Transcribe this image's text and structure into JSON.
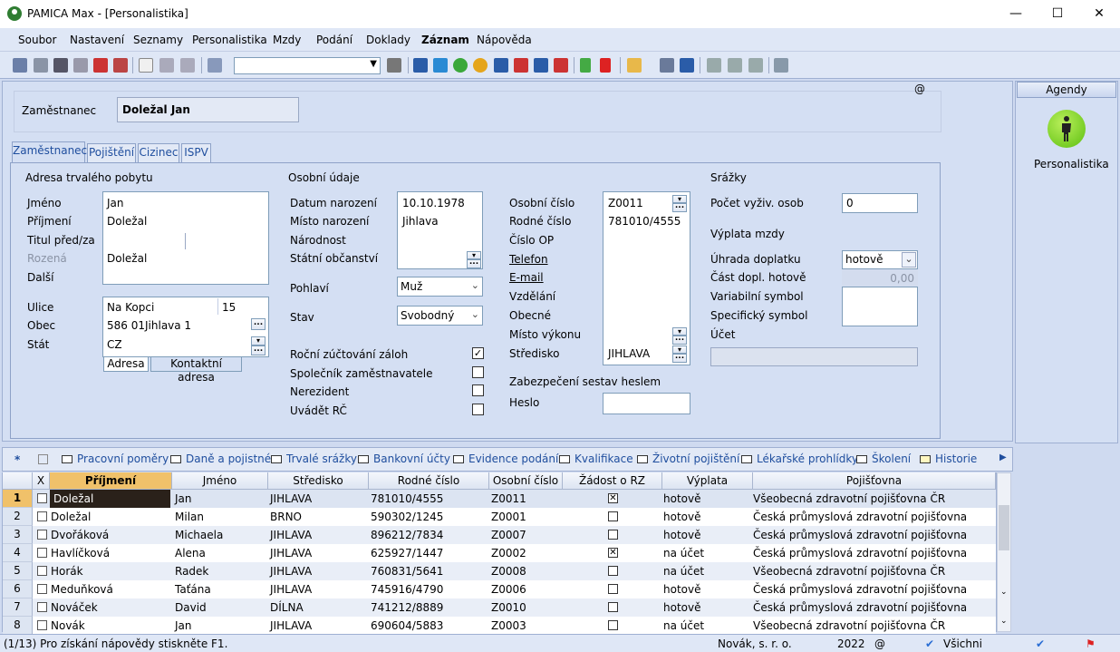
{
  "window": {
    "title": "PAMICA Max - [Personalistika]",
    "minimize": "—",
    "maximize": "☐",
    "close": "✕"
  },
  "menu": [
    "Soubor",
    "Nastavení",
    "Seznamy",
    "Personalistika",
    "Mzdy",
    "Podání",
    "Doklady",
    "Záznam",
    "Nápověda"
  ],
  "header": {
    "employee_label": "Zaměstnanec",
    "employee_name": "Doležal Jan",
    "at_sign": "@"
  },
  "tabs": [
    "Zaměstnanec",
    "Pojištění",
    "Cizinec",
    "ISPV"
  ],
  "address": {
    "section": "Adresa trvalého pobytu",
    "labels": {
      "first_name": "Jméno",
      "last_name": "Příjmení",
      "title": "Titul před/za",
      "born": "Rozená",
      "other": "Další",
      "street": "Ulice",
      "city": "Obec",
      "country": "Stát"
    },
    "first_name": "Jan",
    "last_name": "Doležal",
    "other": "Doležal",
    "street": "Na Kopci",
    "house_no": "15",
    "zip": "586 01",
    "city": "Jihlava 1",
    "country": "CZ",
    "subtabs": [
      "Adresa",
      "Kontaktní adresa"
    ]
  },
  "personal": {
    "section": "Osobní údaje",
    "labels": {
      "dob": "Datum narození",
      "pob": "Místo narození",
      "nationality": "Národnost",
      "citizenship": "Státní občanství",
      "sex": "Pohlaví",
      "status": "Stav"
    },
    "dob": "10.10.1978",
    "pob": "Jihlava",
    "sex": "Muž",
    "status": "Svobodný",
    "checks": [
      {
        "label": "Roční zúčtování záloh",
        "checked": "✓"
      },
      {
        "label": "Společník zaměstnavatele",
        "checked": ""
      },
      {
        "label": "Nerezident",
        "checked": ""
      },
      {
        "label": "Uvádět RČ",
        "checked": ""
      }
    ]
  },
  "ids": {
    "labels": {
      "personal_no": "Osobní číslo",
      "birth_no": "Rodné číslo",
      "id_card": "Číslo OP",
      "phone": "Telefon",
      "email": "E-mail",
      "education": "Vzdělání",
      "municipality": "Obecné",
      "workplace": "Místo výkonu",
      "center": "Středisko"
    },
    "personal_no": "Z0011",
    "birth_no": "781010/4555",
    "center": "JIHLAVA",
    "security_label": "Zabezpečení sestav heslem",
    "password_label": "Heslo"
  },
  "deductions": {
    "section": "Srážky",
    "dependents_label": "Počet vyživ. osob",
    "dependents": "0",
    "payout_section": "Výplata mzdy",
    "payment_label": "Úhrada doplatku",
    "payment": "hotově",
    "cash_part_label": "Část dopl. hotově",
    "cash_part": "0,00",
    "variable_label": "Variabilní symbol",
    "specific_label": "Specifický symbol",
    "account_label": "Účet"
  },
  "agendy": {
    "title": "Agendy",
    "item": "Personalistika"
  },
  "lower_tabs": [
    "Pracovní poměry",
    "Daně a pojistné",
    "Trvalé srážky",
    "Bankovní účty",
    "Evidence podání",
    "Kvalifikace",
    "Životní pojištění",
    "Lékařské prohlídky",
    "Školení",
    "Historie"
  ],
  "grid": {
    "star": "*",
    "columns": [
      "X",
      "Příjmení",
      "Jméno",
      "Středisko",
      "Rodné číslo",
      "Osobní číslo",
      "Žádost o RZ",
      "Výplata",
      "Pojišťovna"
    ],
    "rows": [
      {
        "n": "1",
        "last": "Doležal",
        "first": "Jan",
        "center": "JIHLAVA",
        "rc": "781010/4555",
        "os": "Z0011",
        "rz": "✕",
        "pay": "hotově",
        "ins": "Všeobecná zdravotní pojišťovna ČR"
      },
      {
        "n": "2",
        "last": "Doležal",
        "first": "Milan",
        "center": "BRNO",
        "rc": "590302/1245",
        "os": "Z0001",
        "rz": "",
        "pay": "hotově",
        "ins": "Česká průmyslová zdravotní pojišťovna"
      },
      {
        "n": "3",
        "last": "Dvořáková",
        "first": "Michaela",
        "center": "JIHLAVA",
        "rc": "896212/7834",
        "os": "Z0007",
        "rz": "",
        "pay": "hotově",
        "ins": "Česká průmyslová zdravotní pojišťovna"
      },
      {
        "n": "4",
        "last": "Havlíčková",
        "first": "Alena",
        "center": "JIHLAVA",
        "rc": "625927/1447",
        "os": "Z0002",
        "rz": "✕",
        "pay": "na účet",
        "ins": "Česká průmyslová zdravotní pojišťovna"
      },
      {
        "n": "5",
        "last": "Horák",
        "first": "Radek",
        "center": "JIHLAVA",
        "rc": "760831/5641",
        "os": "Z0008",
        "rz": "",
        "pay": "na účet",
        "ins": "Všeobecná zdravotní pojišťovna ČR"
      },
      {
        "n": "6",
        "last": "Meduňková",
        "first": "Taťána",
        "center": "JIHLAVA",
        "rc": "745916/4790",
        "os": "Z0006",
        "rz": "",
        "pay": "hotově",
        "ins": "Česká průmyslová zdravotní pojišťovna"
      },
      {
        "n": "7",
        "last": "Nováček",
        "first": "David",
        "center": "DÍLNA",
        "rc": "741212/8889",
        "os": "Z0010",
        "rz": "",
        "pay": "hotově",
        "ins": "Česká průmyslová zdravotní pojišťovna"
      },
      {
        "n": "8",
        "last": "Novák",
        "first": "Jan",
        "center": "JIHLAVA",
        "rc": "690604/5883",
        "os": "Z0003",
        "rz": "",
        "pay": "na účet",
        "ins": "Všeobecná zdravotní pojišťovna ČR"
      }
    ]
  },
  "status": {
    "hint": "(1/13) Pro získání nápovědy stiskněte F1.",
    "company": "Novák, s. r. o.",
    "year": "2022",
    "at": "@",
    "filter": "Všichni"
  }
}
